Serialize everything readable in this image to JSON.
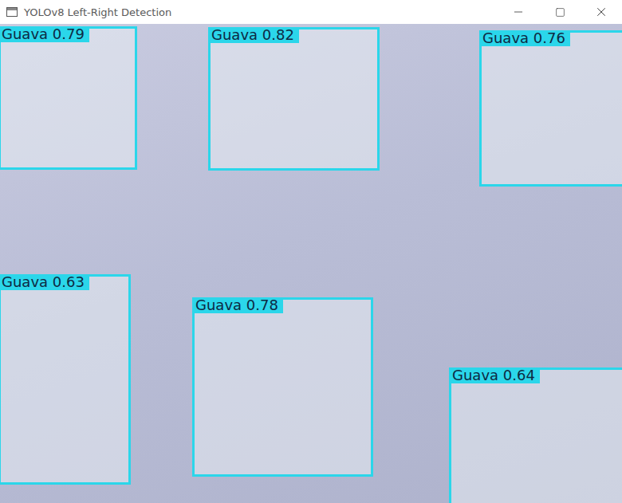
{
  "window": {
    "title": "YOLOv8 Left-Right Detection"
  },
  "detections": [
    {
      "label": "Guava 0.79"
    },
    {
      "label": "Guava 0.82"
    },
    {
      "label": "Guava 0.76"
    },
    {
      "label": "Guava 0.63"
    },
    {
      "label": "Guava 0.78"
    },
    {
      "label": "Guava 0.64"
    }
  ]
}
